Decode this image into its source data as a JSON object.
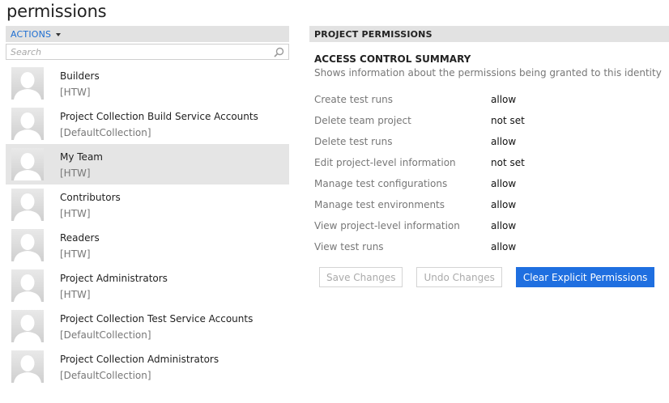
{
  "page": {
    "title": "permissions"
  },
  "left_panel": {
    "actions_label": "ACTIONS",
    "search_placeholder": "Search",
    "groups": [
      {
        "name": "Builders",
        "scope": "[HTW]",
        "selected": false
      },
      {
        "name": "Project Collection Build Service Accounts",
        "scope": "[DefaultCollection]",
        "selected": false
      },
      {
        "name": "My Team",
        "scope": "[HTW]",
        "selected": true
      },
      {
        "name": "Contributors",
        "scope": "[HTW]",
        "selected": false
      },
      {
        "name": "Readers",
        "scope": "[HTW]",
        "selected": false
      },
      {
        "name": "Project Administrators",
        "scope": "[HTW]",
        "selected": false
      },
      {
        "name": "Project Collection Test Service Accounts",
        "scope": "[DefaultCollection]",
        "selected": false
      },
      {
        "name": "Project Collection Administrators",
        "scope": "[DefaultCollection]",
        "selected": false
      }
    ]
  },
  "right_panel": {
    "header": "PROJECT PERMISSIONS",
    "summary_title": "ACCESS CONTROL SUMMARY",
    "summary_desc": "Shows information about the permissions being granted to this identity",
    "permissions": [
      {
        "name": "Create test runs",
        "value": "allow"
      },
      {
        "name": "Delete team project",
        "value": "not set"
      },
      {
        "name": "Delete test runs",
        "value": "allow"
      },
      {
        "name": "Edit project-level information",
        "value": "not set"
      },
      {
        "name": "Manage test configurations",
        "value": "allow"
      },
      {
        "name": "Manage test environments",
        "value": "allow"
      },
      {
        "name": "View project-level information",
        "value": "allow"
      },
      {
        "name": "View test runs",
        "value": "allow"
      }
    ],
    "buttons": {
      "save": "Save Changes",
      "undo": "Undo Changes",
      "clear": "Clear Explicit Permissions"
    }
  },
  "colors": {
    "accent": "#1f6fe0",
    "link": "#1f6fd1",
    "header_bg": "#e2e2e2",
    "selected_bg": "#e5e5e5"
  }
}
